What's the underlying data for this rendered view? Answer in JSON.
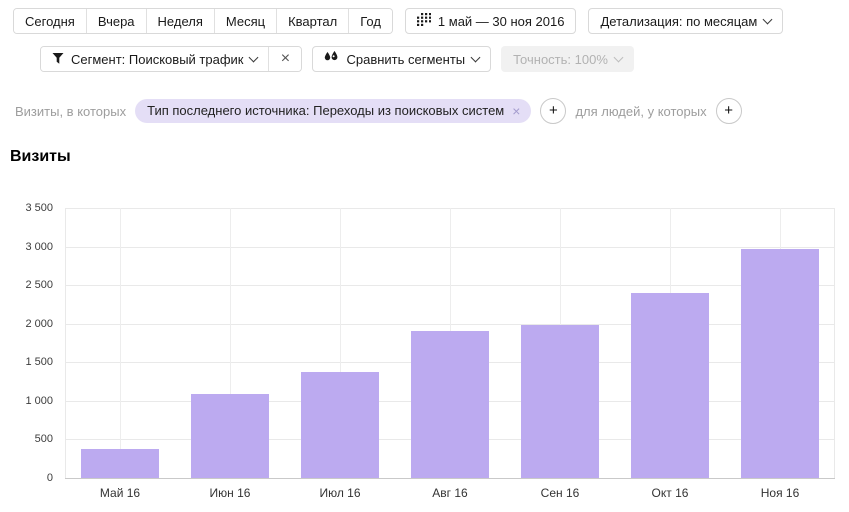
{
  "toolbar": {
    "period_tabs": [
      "Сегодня",
      "Вчера",
      "Неделя",
      "Месяц",
      "Квартал",
      "Год"
    ],
    "date_range_label": "1 май — 30 ноя 2016",
    "detalization_label": "Детализация: по месяцам"
  },
  "segment_bar": {
    "segment_label": "Сегмент: Поисковый трафик",
    "segment_close_glyph": "×",
    "compare_label": "Сравнить сегменты",
    "accuracy_label": "Точность: 100%"
  },
  "filter_bar": {
    "visits_prefix": "Визиты, в которых",
    "segment_tag": "Тип последнего источника: Переходы из поисковых систем",
    "tag_close_glyph": "×",
    "plus_glyph": "+",
    "people_prefix": "для людей, у которых"
  },
  "chart": {
    "title": "Визиты"
  },
  "chart_data": {
    "type": "bar",
    "title": "Визиты",
    "categories": [
      "Май 16",
      "Июн 16",
      "Июл 16",
      "Авг 16",
      "Сен 16",
      "Окт 16",
      "Ноя 16"
    ],
    "values": [
      370,
      1090,
      1380,
      1900,
      1980,
      2400,
      2970
    ],
    "xlabel": "",
    "ylabel": "",
    "ylim": [
      0,
      3500
    ],
    "ytick_step": 500,
    "ytick_labels": [
      "3 500",
      "3 000",
      "2 500",
      "2 000",
      "1 500",
      "1 000",
      "500",
      "0"
    ],
    "bar_color": "#bcaaf0",
    "grid": true,
    "legend_position": "none"
  },
  "colors": {
    "accent_purple": "#bcaaf0",
    "tag_background": "#e4def6",
    "button_border": "#d9d9d9",
    "disabled_text": "#b2b2b2"
  }
}
